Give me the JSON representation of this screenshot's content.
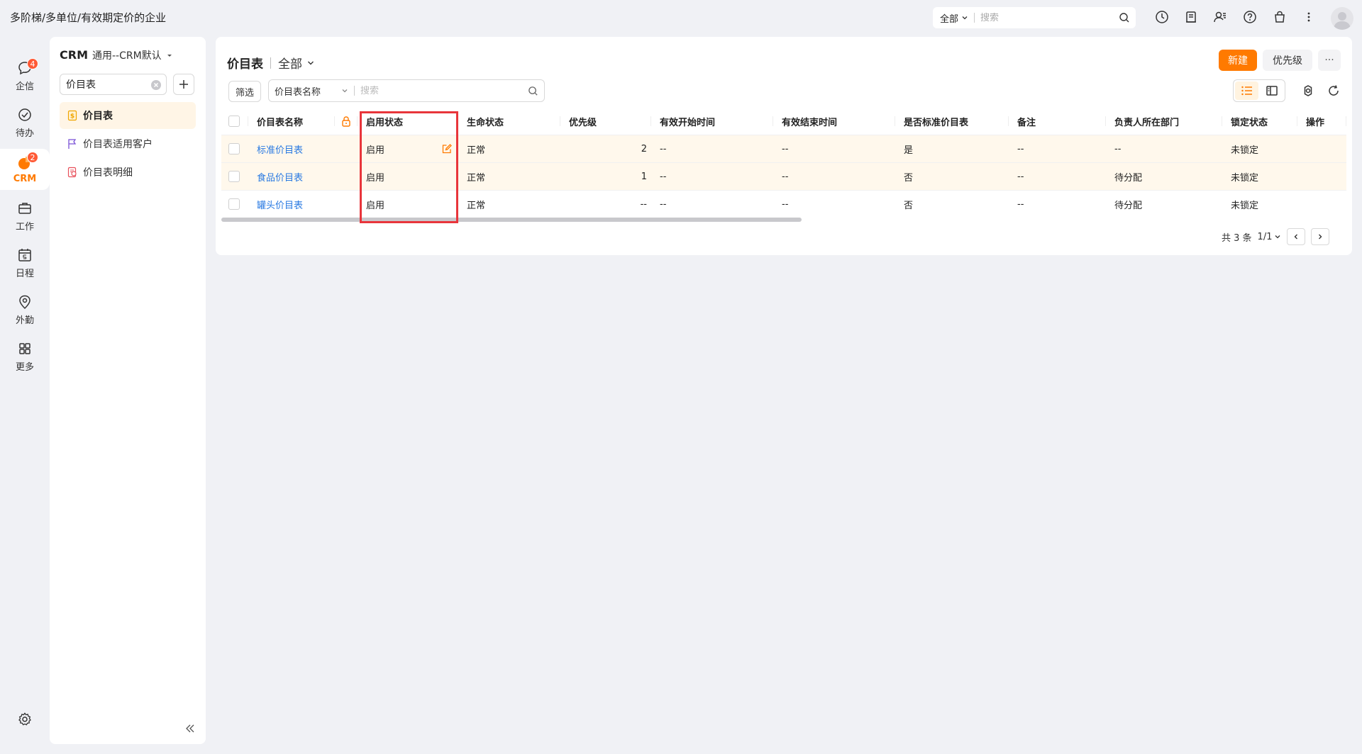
{
  "topbar": {
    "company": "多阶梯/多单位/有效期定价的企业",
    "search_scope": "全部",
    "search_placeholder": "搜索"
  },
  "rail": {
    "items": [
      {
        "label": "企信",
        "badge": "4"
      },
      {
        "label": "待办",
        "badge": ""
      },
      {
        "label": "CRM",
        "badge": "2"
      },
      {
        "label": "工作",
        "badge": ""
      },
      {
        "label": "日程",
        "badge": ""
      },
      {
        "label": "外勤",
        "badge": ""
      },
      {
        "label": "更多",
        "badge": ""
      }
    ]
  },
  "sidebar": {
    "title": "CRM",
    "subtitle": "通用--CRM默认",
    "search_value": "价目表",
    "items": [
      {
        "label": "价目表"
      },
      {
        "label": "价目表适用客户"
      },
      {
        "label": "价目表明细"
      }
    ]
  },
  "main": {
    "title": "价目表",
    "scope": "全部",
    "new_label": "新建",
    "priority_label": "优先级",
    "more_label": "···",
    "filter_label": "筛选",
    "filter_field": "价目表名称",
    "filter_placeholder": "搜索"
  },
  "table": {
    "headers": {
      "name": "价目表名称",
      "status": "启用状态",
      "life": "生命状态",
      "prio": "优先级",
      "start": "有效开始时间",
      "end": "有效结束时间",
      "std": "是否标准价目表",
      "remark": "备注",
      "dept": "负责人所在部门",
      "lockst": "锁定状态",
      "op": "操作"
    },
    "rows": [
      {
        "name": "标准价目表",
        "status": "启用",
        "life": "正常",
        "prio": "2",
        "start": "--",
        "end": "--",
        "std": "是",
        "remark": "--",
        "dept": "--",
        "lockst": "未锁定"
      },
      {
        "name": "食品价目表",
        "status": "启用",
        "life": "正常",
        "prio": "1",
        "start": "--",
        "end": "--",
        "std": "否",
        "remark": "--",
        "dept": "待分配",
        "lockst": "未锁定"
      },
      {
        "name": "罐头价目表",
        "status": "启用",
        "life": "正常",
        "prio": "--",
        "start": "--",
        "end": "--",
        "std": "否",
        "remark": "--",
        "dept": "待分配",
        "lockst": "未锁定"
      }
    ]
  },
  "pager": {
    "total": "共 3 条",
    "page": "1/1"
  },
  "colors": {
    "accent": "#ff7a00",
    "link": "#2a7ae2",
    "badge": "#ff5a36",
    "highlight": "#e8353b"
  }
}
